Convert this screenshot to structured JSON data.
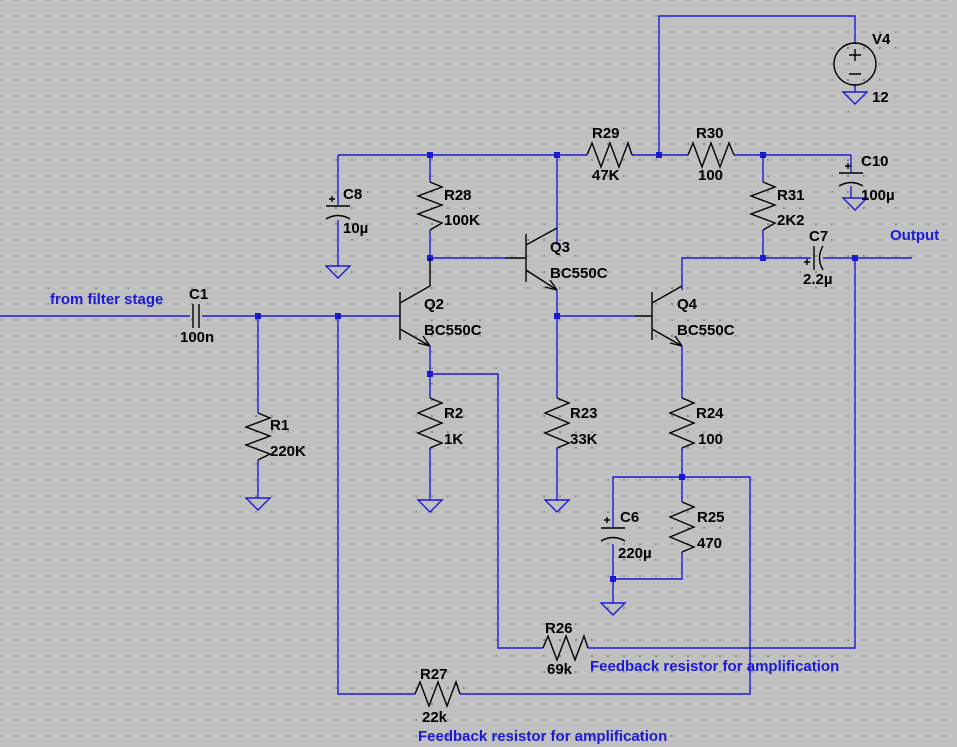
{
  "components": {
    "c1": {
      "name": "C1",
      "value": "100n"
    },
    "r1": {
      "name": "R1",
      "value": "220K"
    },
    "c8": {
      "name": "C8",
      "value": "10µ"
    },
    "r28": {
      "name": "R28",
      "value": "100K"
    },
    "q2": {
      "name": "Q2",
      "value": "BC550C"
    },
    "q3": {
      "name": "Q3",
      "value": "BC550C"
    },
    "q4": {
      "name": "Q4",
      "value": "BC550C"
    },
    "r2": {
      "name": "R2",
      "value": "1K"
    },
    "r23": {
      "name": "R23",
      "value": "33K"
    },
    "r29": {
      "name": "R29",
      "value": "47K"
    },
    "r30": {
      "name": "R30",
      "value": "100"
    },
    "v4": {
      "name": "V4",
      "value": "12"
    },
    "c10": {
      "name": "C10",
      "value": "100µ"
    },
    "r31": {
      "name": "R31",
      "value": "2K2"
    },
    "c7": {
      "name": "C7",
      "value": "2.2µ"
    },
    "r24": {
      "name": "R24",
      "value": "100"
    },
    "c6": {
      "name": "C6",
      "value": "220µ"
    },
    "r25": {
      "name": "R25",
      "value": "470"
    },
    "r26": {
      "name": "R26",
      "value": "69k"
    },
    "r27": {
      "name": "R27",
      "value": "22k"
    }
  },
  "net_labels": {
    "input": "from filter stage",
    "output": "Output"
  },
  "notes": {
    "r26_note": "Feedback resistor for amplification",
    "r27_note": "Feedback resistor for amplification"
  },
  "colors": {
    "wire": "#1a1ad6",
    "component": "#000000",
    "background": "#c0c0c0"
  }
}
